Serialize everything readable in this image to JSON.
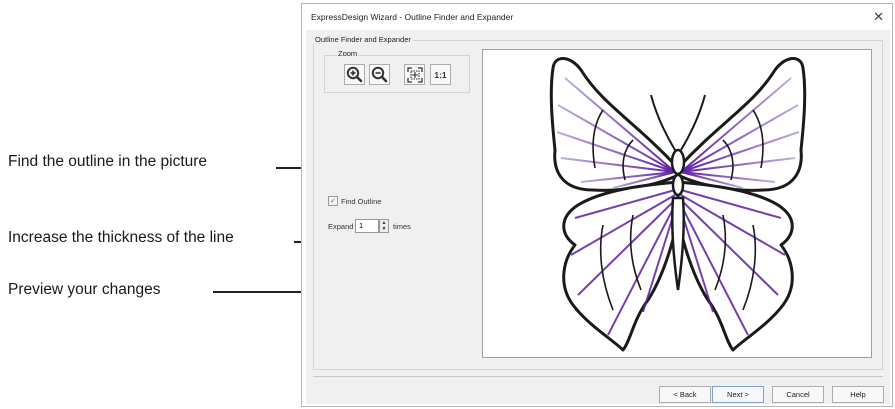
{
  "callouts": {
    "find_outline": "Find the outline in the picture",
    "thickness": "Increase the thickness of the line",
    "preview": "Preview your changes"
  },
  "dialog": {
    "title": "ExpressDesign Wizard - Outline Finder and Expander",
    "close_glyph": "✕",
    "group_label": "Outline Finder and Expander",
    "zoom": {
      "label": "Zoom",
      "buttons": [
        "zoom-in-icon",
        "zoom-out-icon",
        "zoom-fit-icon",
        "1:1"
      ]
    },
    "find_outline": {
      "label": "Find Outline",
      "checked": true
    },
    "expand": {
      "label": "Expand",
      "value": "1",
      "suffix": "times"
    },
    "buttons": {
      "back": "< Back",
      "next": "Next >",
      "cancel": "Cancel",
      "help": "Help"
    }
  },
  "colors": {
    "accent": "#7030a0",
    "outline": "#1a1a1a",
    "dialog_bg": "#f0f0f0"
  }
}
